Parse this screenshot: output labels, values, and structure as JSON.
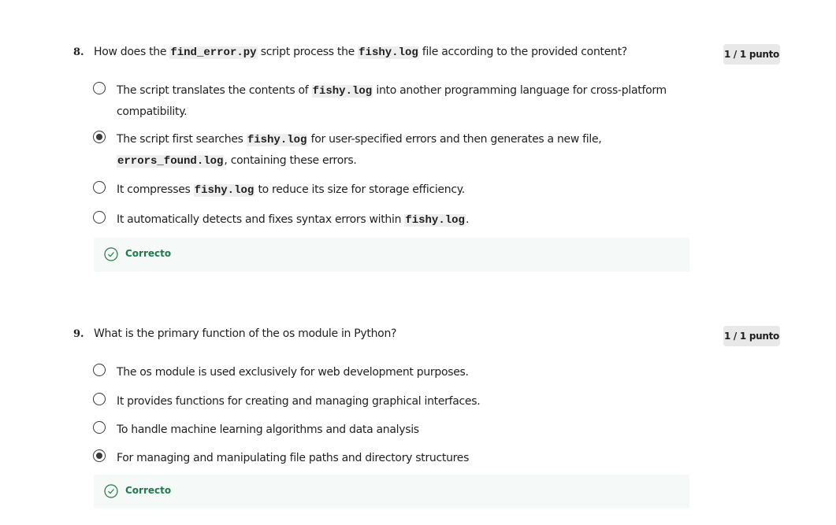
{
  "questions": [
    {
      "number": "8.",
      "text": [
        {
          "t": "How does the "
        },
        {
          "t": "find_error.py",
          "code": true
        },
        {
          "t": " script process the "
        },
        {
          "t": "fishy.log",
          "code": true
        },
        {
          "t": " file according to the provided content?"
        }
      ],
      "score": "1 / 1 punto",
      "options": [
        {
          "selected": false,
          "text": [
            {
              "t": "The script translates the contents of "
            },
            {
              "t": "fishy.log",
              "code": true
            },
            {
              "t": " into another programming language for cross-platform compatibility."
            }
          ]
        },
        {
          "selected": true,
          "text": [
            {
              "t": "The script first searches "
            },
            {
              "t": "fishy.log",
              "code": true
            },
            {
              "t": " for user-specified errors and then generates a new file, "
            },
            {
              "t": "errors_found.log",
              "code": true
            },
            {
              "t": ", containing these errors."
            }
          ]
        },
        {
          "selected": false,
          "text": [
            {
              "t": "It compresses "
            },
            {
              "t": "fishy.log",
              "code": true
            },
            {
              "t": " to reduce its size for storage efficiency."
            }
          ]
        },
        {
          "selected": false,
          "text": [
            {
              "t": "It automatically detects and fixes syntax errors within "
            },
            {
              "t": "fishy.log",
              "code": true
            },
            {
              "t": "."
            }
          ]
        }
      ],
      "feedback": "Correcto"
    },
    {
      "number": "9.",
      "text": [
        {
          "t": "What is the primary function of the os module in Python?"
        }
      ],
      "score": "1 / 1 punto",
      "options": [
        {
          "selected": false,
          "text": [
            {
              "t": "The os module is used exclusively for web development purposes."
            }
          ]
        },
        {
          "selected": false,
          "text": [
            {
              "t": "It provides functions for creating and managing graphical interfaces."
            }
          ]
        },
        {
          "selected": false,
          "text": [
            {
              "t": "To handle machine learning algorithms and data analysis"
            }
          ]
        },
        {
          "selected": true,
          "text": [
            {
              "t": "For managing and manipulating file paths and directory structures"
            }
          ]
        }
      ],
      "feedback": "Correcto"
    }
  ],
  "colors": {
    "correct": "#1f7a4c"
  }
}
